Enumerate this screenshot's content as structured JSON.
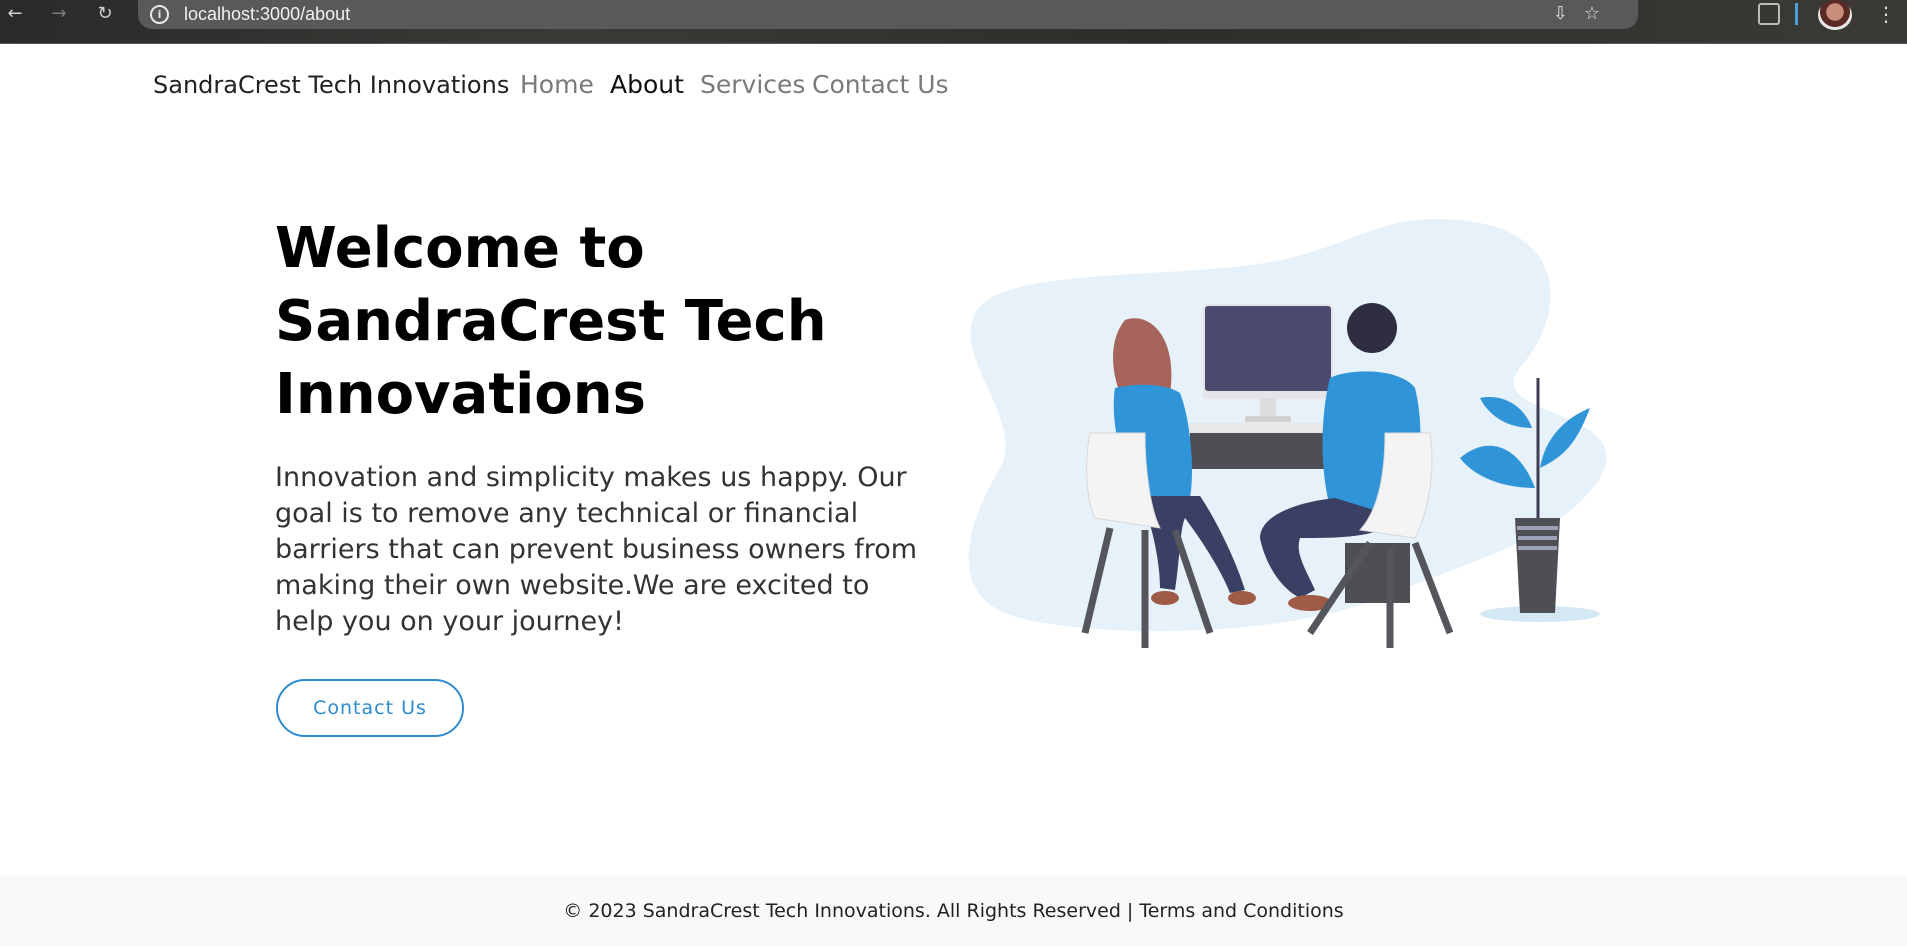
{
  "browser": {
    "url": "localhost:3000/about",
    "back_glyph": "←",
    "forward_glyph": "→",
    "reload_glyph": "↻",
    "info_glyph": "i",
    "install_glyph": "⇩",
    "star_glyph": "☆",
    "menu_glyph": "⋮",
    "icons": [
      "back-arrow-icon",
      "forward-arrow-icon",
      "reload-icon",
      "site-info-icon",
      "install-app-icon",
      "bookmark-star-icon",
      "extensions-icon",
      "profile-avatar",
      "menu-icon"
    ]
  },
  "navbar": {
    "brand": "SandraCrest Tech Innovations",
    "links": [
      {
        "label": "Home",
        "active": false
      },
      {
        "label": "About",
        "active": true
      },
      {
        "label": "Services",
        "active": false
      },
      {
        "label": "Contact Us",
        "active": false
      }
    ]
  },
  "hero": {
    "title": "Welcome to SandraCrest Tech Innovations",
    "text": "Innovation and simplicity makes us happy. Our goal is to remove any technical or financial barriers that can prevent business owners from making their own website.We are excited to help you on your journey!",
    "cta_label": "Contact Us",
    "accent_color": "#2d8ccf"
  },
  "footer": {
    "copyright": "© 2023 SandraCrest Tech Innovations. All Rights Reserved |",
    "terms_label": "Terms and Conditions"
  }
}
